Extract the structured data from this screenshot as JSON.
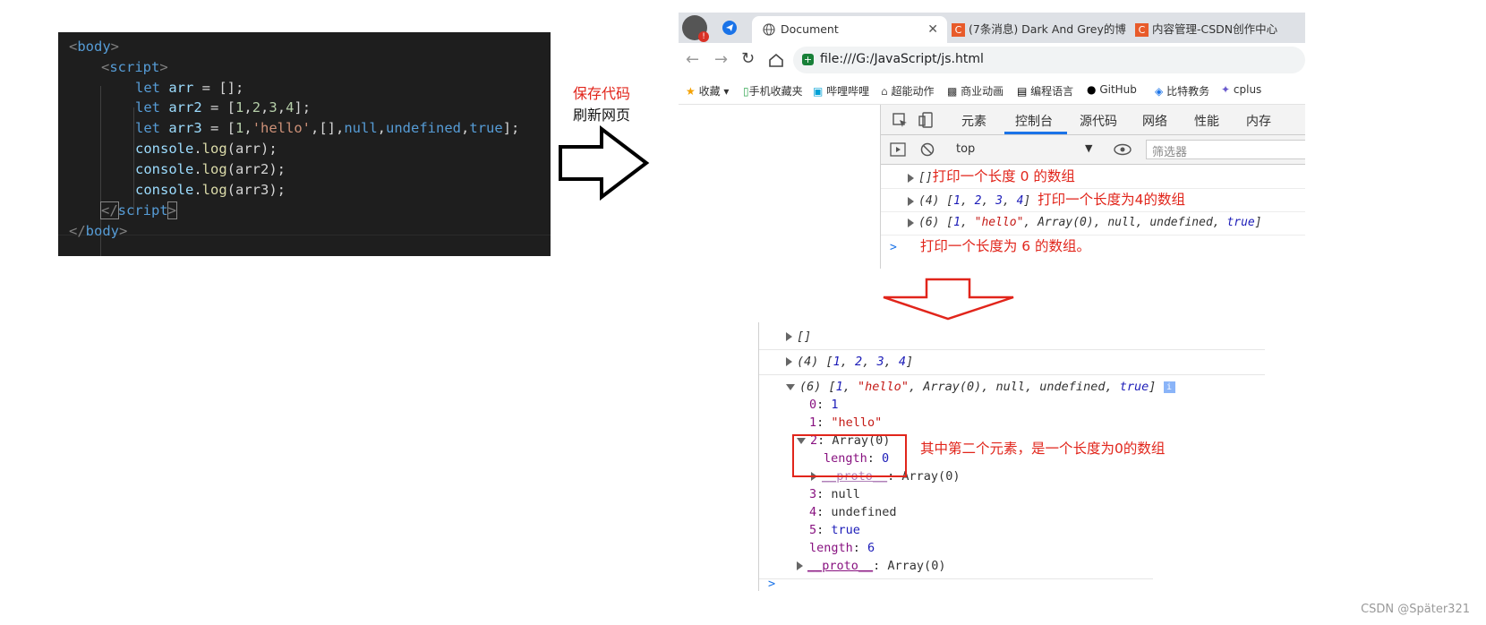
{
  "editor": {
    "lines": [
      {
        "open": "<",
        "name": "body",
        "close": ">"
      },
      {
        "open": "<",
        "name": "script",
        "close": ">"
      },
      {
        "kw": "let",
        "id": "arr",
        "rest": " = [];"
      },
      {
        "kw": "let",
        "id": "arr2",
        "p1": " = [",
        "n1": "1",
        "c1": ",",
        "n2": "2",
        "c2": ",",
        "n3": "3",
        "c3": ",",
        "n4": "4",
        "p2": "];"
      },
      {
        "kw": "let",
        "id": "arr3",
        "p1": " = [",
        "n1": "1",
        "c1": ",",
        "s1": "'hello'",
        "c2": ",[],",
        "k1": "null",
        "c3": ",",
        "k2": "undefined",
        "c4": ",",
        "k3": "true",
        "p2": "];"
      },
      {
        "obj": "console",
        "dot": ".",
        "fn": "log",
        "arg": "(arr);"
      },
      {
        "obj": "console",
        "dot": ".",
        "fn": "log",
        "arg": "(arr2);"
      },
      {
        "obj": "console",
        "dot": ".",
        "fn": "log",
        "arg": "(arr3);"
      },
      {
        "open": "</",
        "name": "script",
        "close": ">"
      },
      {
        "open": "</",
        "name": "body",
        "close": ">"
      }
    ]
  },
  "annotation": {
    "red": "保存代码",
    "black": "刷新网页"
  },
  "browser": {
    "tabs": [
      {
        "title": "Document"
      },
      {
        "title": "(7条消息) Dark And Grey的博"
      },
      {
        "title": "内容管理-CSDN创作中心"
      }
    ],
    "url": "file:///G:/JavaScript/js.html",
    "bookmarks": [
      "收藏",
      "手机收藏夹",
      "哔哩哔哩",
      "超能动作",
      "商业动画",
      "编程语言",
      "GitHub",
      "比特教务",
      "cplus"
    ],
    "devtools_tabs": [
      "元素",
      "控制台",
      "源代码",
      "网络",
      "性能",
      "内存"
    ],
    "context": "top",
    "filter_placeholder": "筛选器",
    "console": {
      "row1": {
        "text": "[]",
        "note": "打印一个长度  0  的数组"
      },
      "row2": {
        "prefix": "(4) [",
        "items": [
          "1",
          "2",
          "3",
          "4"
        ],
        "note": "打印一个长度为4的数组"
      },
      "row3": {
        "prefix": "(6) [",
        "n": "1",
        "s": "\"hello\"",
        "a": "Array(0)",
        "k1": "null",
        "k2": "undefined",
        "k3": "true",
        "suffix": "]"
      },
      "prompt": ">",
      "prompt_note": "打印一个长度为  6  的数组。"
    }
  },
  "console2": {
    "row1": "[]",
    "row2_prefix": "(4) [",
    "row2_items": [
      "1",
      "2",
      "3",
      "4"
    ],
    "row3": {
      "prefix": "(6) [",
      "n": "1",
      "s": "\"hello\"",
      "a": "Array(0)",
      "k1": "null",
      "k2": "undefined",
      "k3": "true",
      "suffix": "]"
    },
    "props": [
      {
        "key": "0",
        "val": "1",
        "type": "num"
      },
      {
        "key": "1",
        "val": "\"hello\"",
        "type": "str"
      },
      {
        "key": "2",
        "val": "Array(0)",
        "type": "plain"
      },
      {
        "key": "length",
        "val": "0",
        "type": "num"
      },
      {
        "key": "__proto__",
        "val": "Array(0)",
        "type": "plain"
      },
      {
        "key": "3",
        "val": "null",
        "type": "plain"
      },
      {
        "key": "4",
        "val": "undefined",
        "type": "plain"
      },
      {
        "key": "5",
        "val": "true",
        "type": "kw"
      },
      {
        "key": "length",
        "val": "6",
        "type": "num"
      },
      {
        "key": "__proto__",
        "val": "Array(0)",
        "type": "plain"
      }
    ],
    "note": "其中第二个元素，是一个长度为0的数组",
    "prompt": ">"
  },
  "watermark": "CSDN @Später321",
  "colors": {
    "annotation_red": "#e1251b",
    "editor_bg": "#1e1e1e",
    "devtools_blue": "#1a73e8"
  }
}
